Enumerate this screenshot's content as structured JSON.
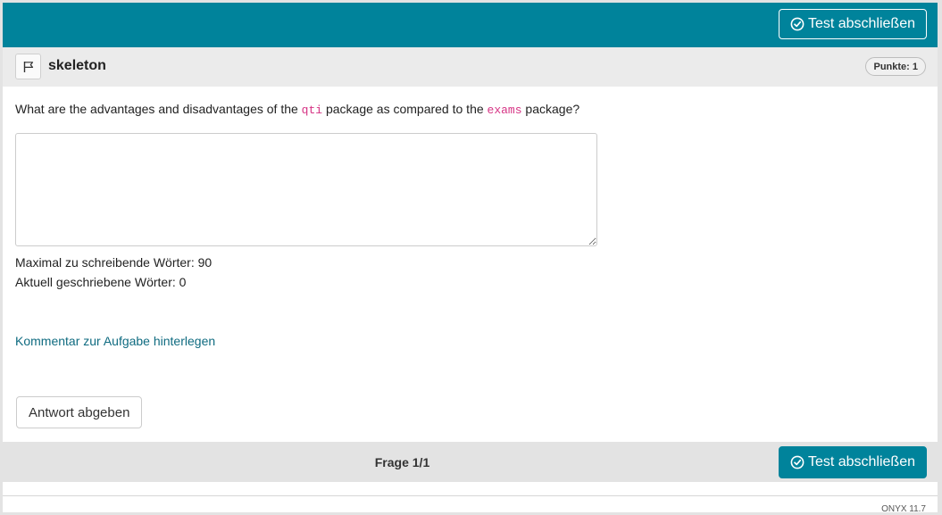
{
  "header": {
    "finish_label": "Test abschließen",
    "finish_icon": "check-circle-icon"
  },
  "item": {
    "flag_icon": "flag-icon",
    "title": "skeleton",
    "points_label": "Punkte: 1"
  },
  "question": {
    "part1": "What are the advantages and disadvantages of the ",
    "code1": "qti",
    "part2": " package as compared to the ",
    "code2": "exams",
    "part3": " package?"
  },
  "answer": {
    "value": "",
    "placeholder": ""
  },
  "word_counts": {
    "max_label": "Maximal zu schreibende Wörter: 90",
    "current_label": "Aktuell geschriebene Wörter: 0"
  },
  "comment_link": "Kommentar zur Aufgabe hinterlegen",
  "submit_label": "Antwort abgeben",
  "footer": {
    "question_counter": "Frage 1/1",
    "finish_label": "Test abschließen"
  },
  "version": "ONYX 11.7",
  "colors": {
    "brand": "#00839b",
    "code": "#d63384",
    "link": "#0f6b80"
  }
}
